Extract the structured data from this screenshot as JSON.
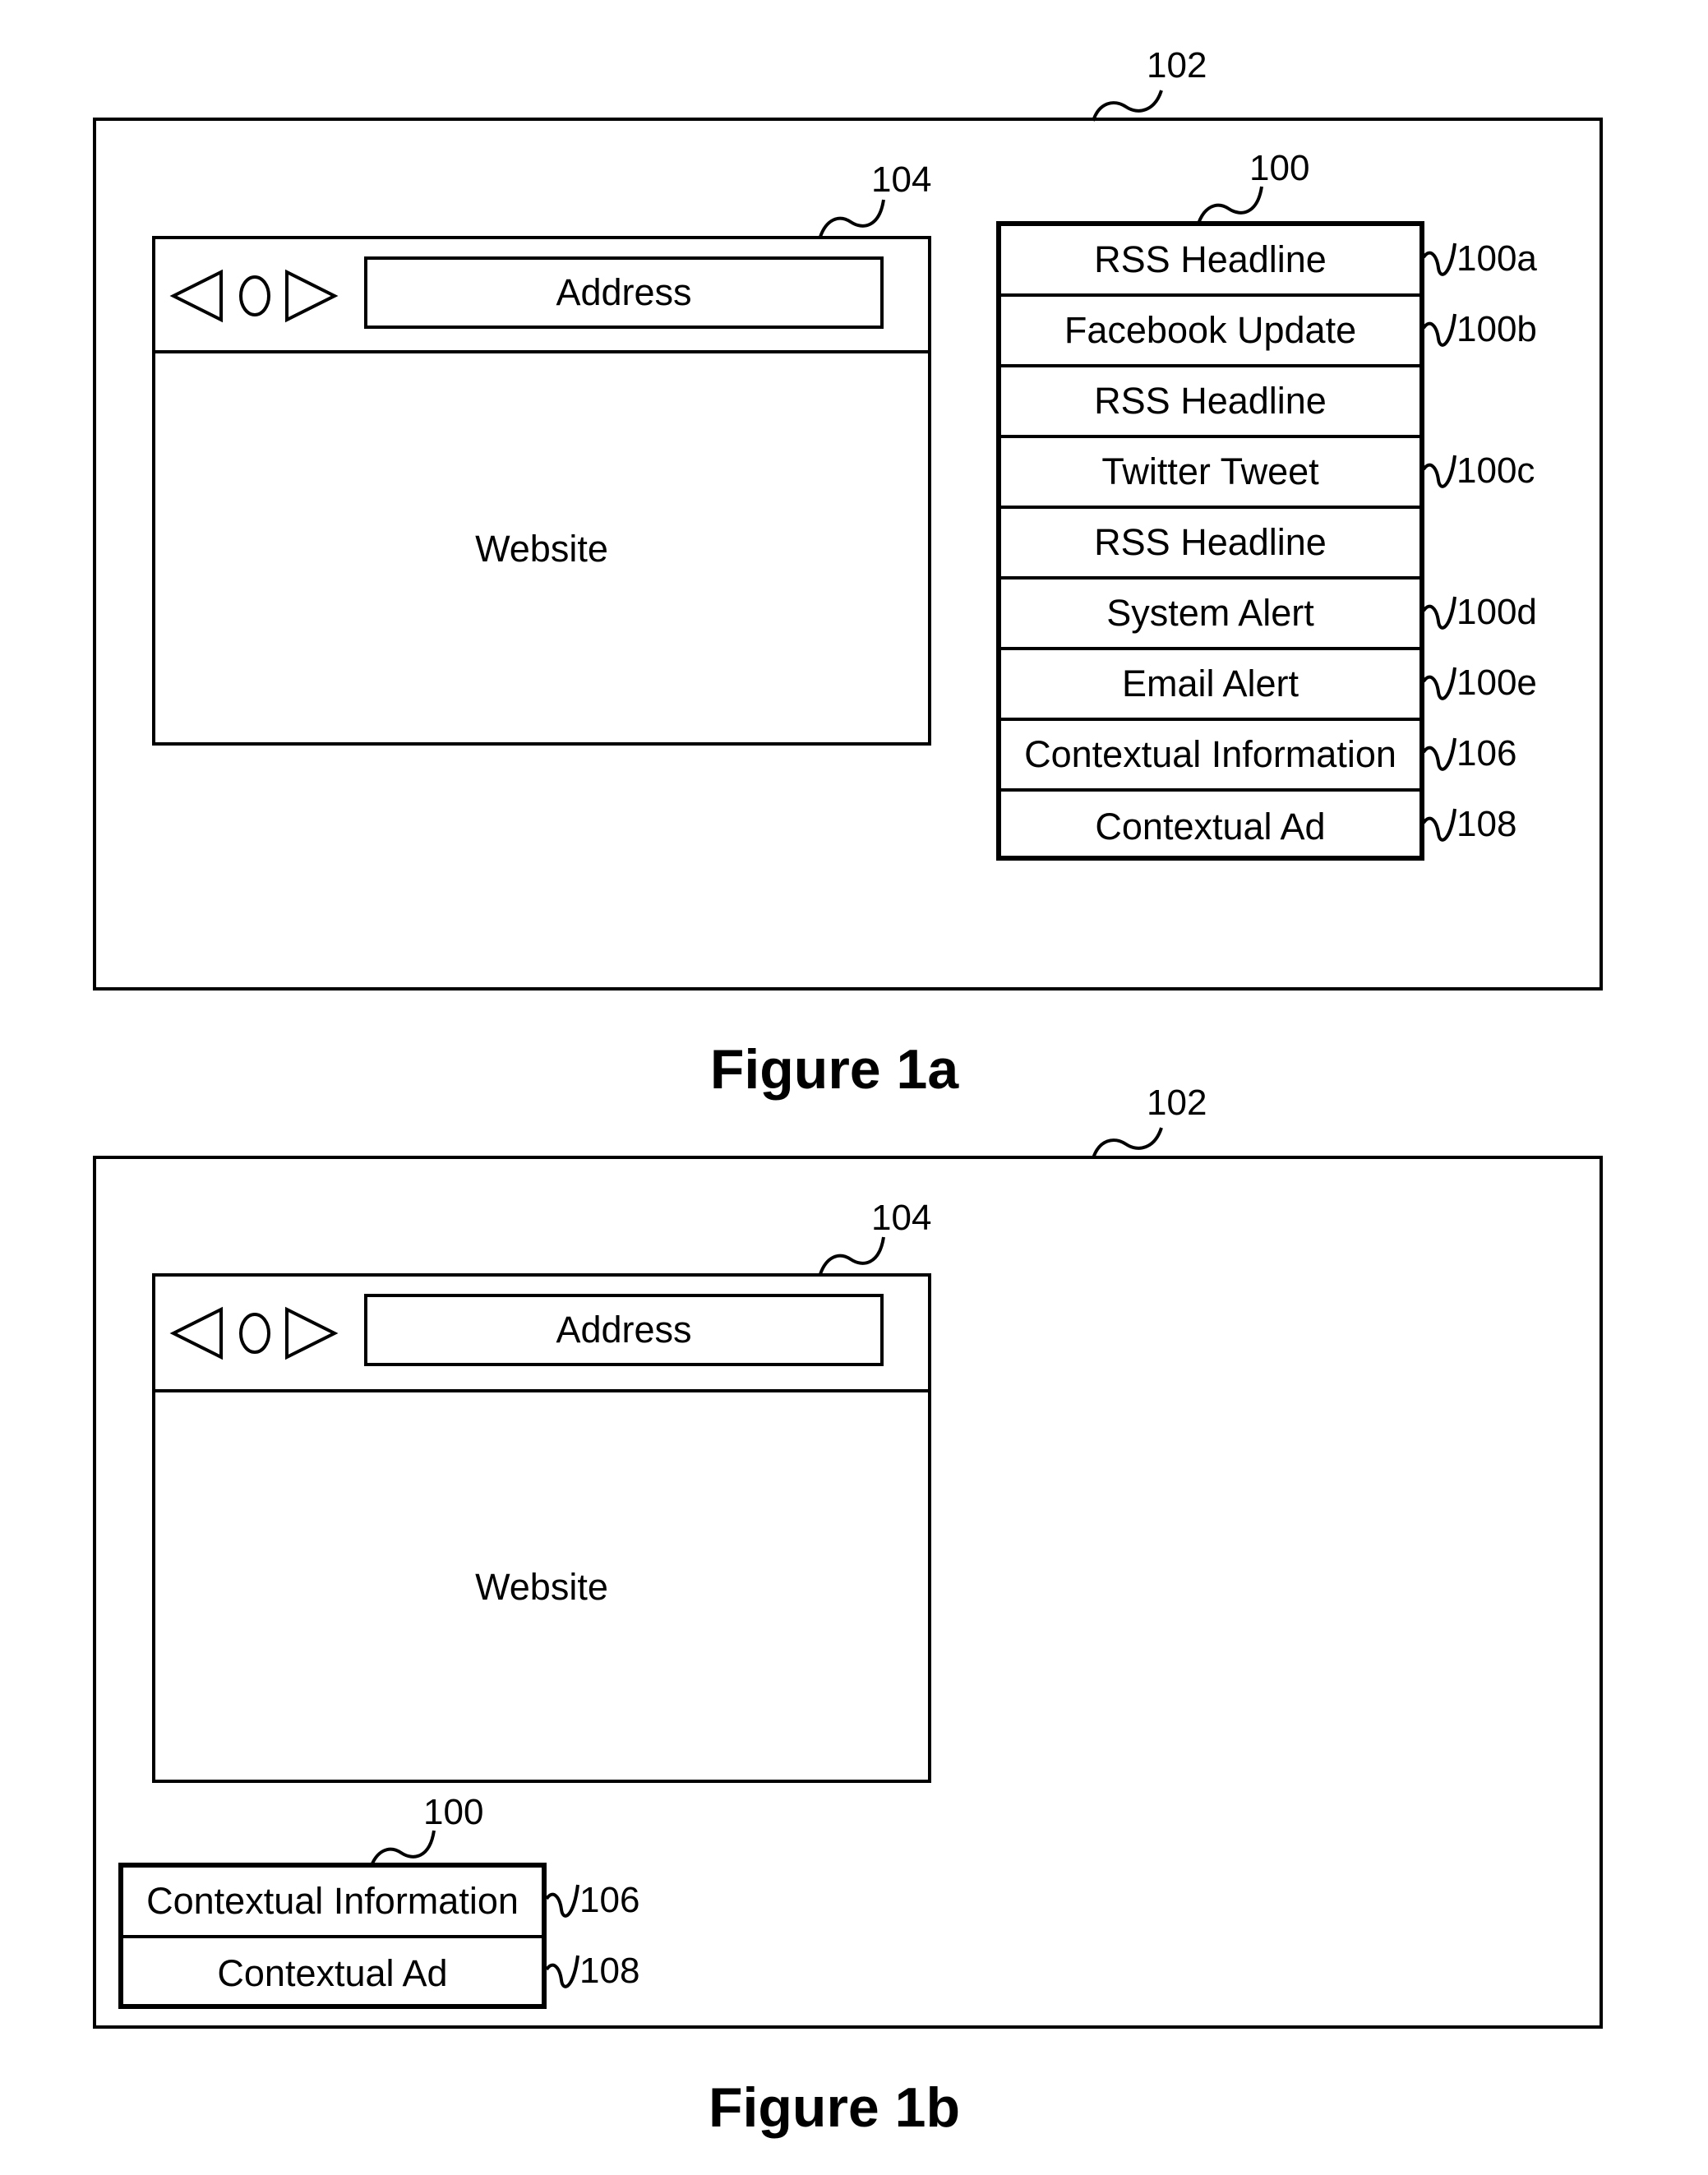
{
  "figures": [
    {
      "caption": "Figure 1a",
      "screen_ref": "102",
      "browser_ref": "104",
      "address_label": "Address",
      "website_label": "Website",
      "panel_ref": "100",
      "panel_items": [
        {
          "label": "RSS Headline",
          "ref": "100a"
        },
        {
          "label": "Facebook Update",
          "ref": "100b"
        },
        {
          "label": "RSS Headline",
          "ref": ""
        },
        {
          "label": "Twitter Tweet",
          "ref": "100c"
        },
        {
          "label": "RSS Headline",
          "ref": ""
        },
        {
          "label": "System Alert",
          "ref": "100d"
        },
        {
          "label": "Email Alert",
          "ref": "100e"
        },
        {
          "label": "Contextual Information",
          "ref": "106"
        },
        {
          "label": "Contextual Ad",
          "ref": "108"
        }
      ]
    },
    {
      "caption": "Figure 1b",
      "screen_ref": "102",
      "browser_ref": "104",
      "address_label": "Address",
      "website_label": "Website",
      "panel_ref": "100",
      "panel_items": [
        {
          "label": "Contextual Information",
          "ref": "106"
        },
        {
          "label": "Contextual Ad",
          "ref": "108"
        }
      ]
    }
  ],
  "icons": [
    "back-arrow-icon",
    "reload-circle-icon",
    "forward-arrow-icon"
  ]
}
